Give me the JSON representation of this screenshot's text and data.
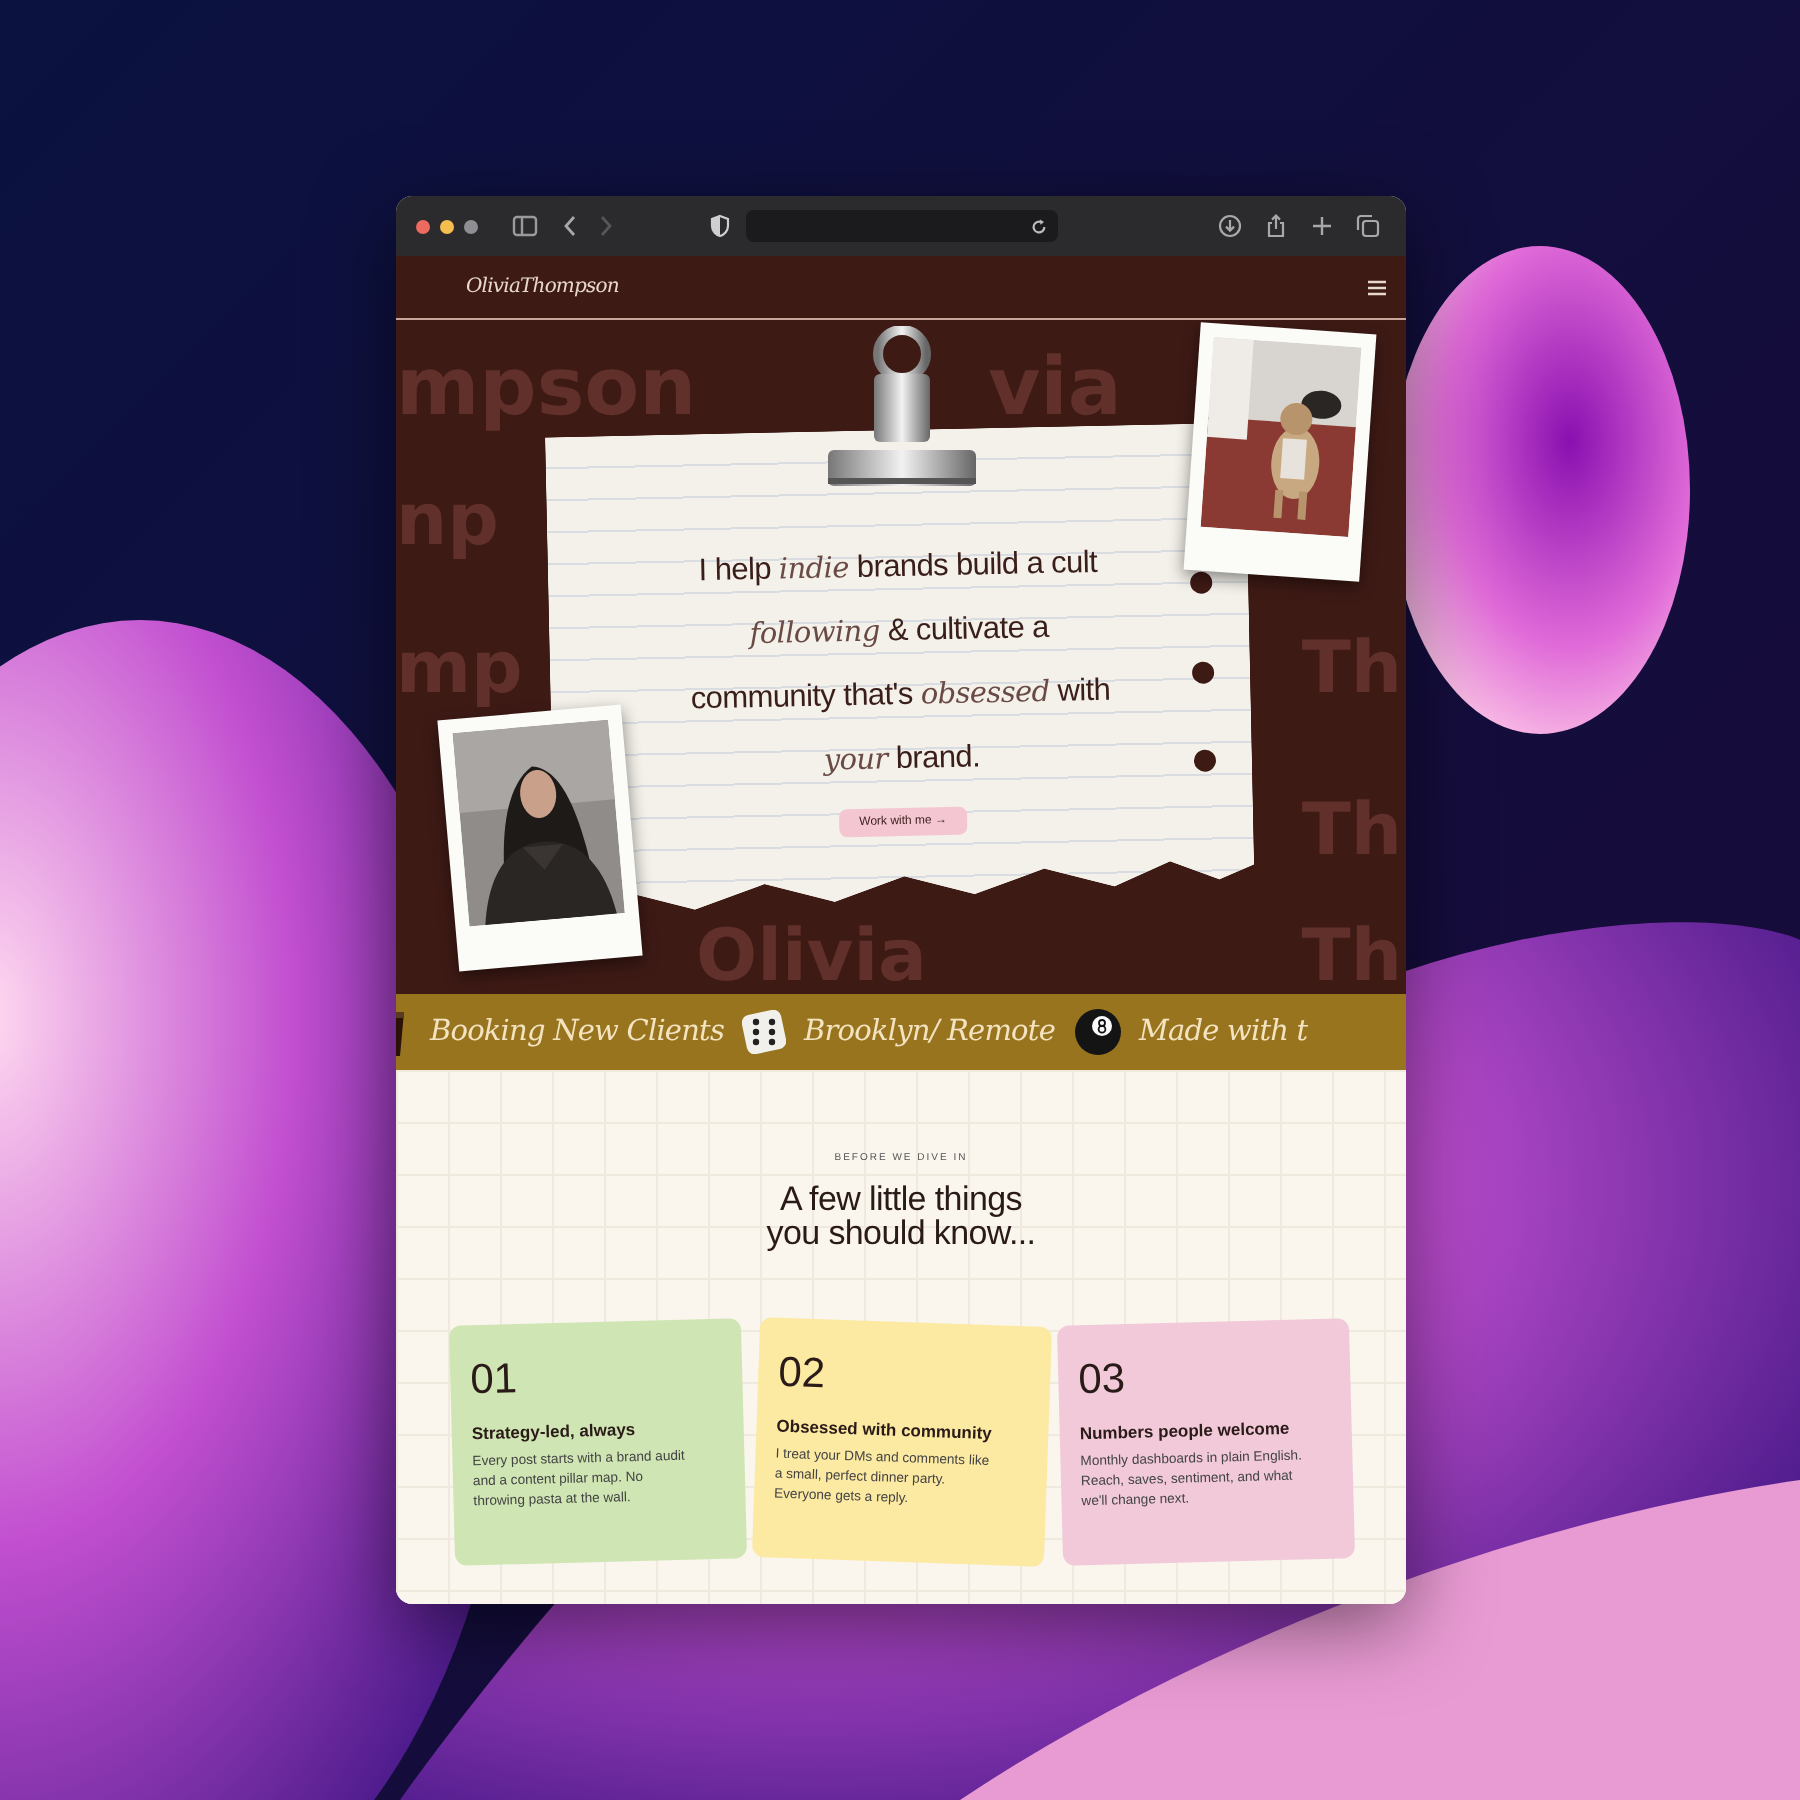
{
  "browser": {
    "traffic_lights": [
      {
        "color": "#ec6a5e"
      },
      {
        "color": "#f4bf4f"
      },
      {
        "color": "#8e8e93"
      }
    ],
    "back_disabled": false,
    "forward_disabled": true
  },
  "site": {
    "logo": "OliviaThompson"
  },
  "hero": {
    "background_rows": [
      {
        "left": "mpson",
        "middle": "via"
      },
      {
        "left": "np"
      },
      {
        "left": "mp",
        "right": "Th"
      },
      {
        "right": "Th"
      },
      {
        "middle": "Olivia",
        "right": "Th"
      }
    ],
    "headline": "I help *indie* brands build a cult *following* & cultivate a community that's *obsessed* with *your* brand.",
    "button": "Work with me →"
  },
  "marquee": [
    {
      "kind": "cup"
    },
    {
      "kind": "text",
      "text": "Booking New Clients"
    },
    {
      "kind": "dice"
    },
    {
      "kind": "text",
      "text": "Brooklyn/ Remote"
    },
    {
      "kind": "ball"
    },
    {
      "kind": "text",
      "text": "Made with t"
    }
  ],
  "intro": {
    "eyebrow": "BEFORE WE DIVE IN",
    "heading": "A few little things you should know..."
  },
  "cards": [
    {
      "number": "01",
      "title": "Strategy-led, always",
      "body": "Every post starts with a brand audit and a content pillar map. No throwing pasta at the wall.",
      "color": "#cfe5b3"
    },
    {
      "number": "02",
      "title": "Obsessed with community",
      "body": "I treat your DMs and comments like a small, perfect dinner party. Everyone gets a reply.",
      "color": "#fce9a2"
    },
    {
      "number": "03",
      "title": "Numbers people welcome",
      "body": "Monthly dashboards in plain English. Reach, saves, sentiment, and what we'll change next.",
      "color": "#f1c9d9"
    }
  ]
}
